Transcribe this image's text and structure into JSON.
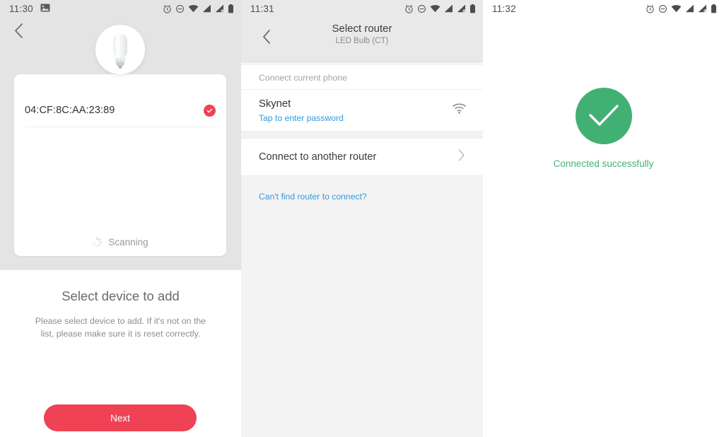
{
  "statusbar": {
    "time_1": "11:30",
    "time_2": "11:31",
    "time_3": "11:32",
    "icons": [
      "image-icon",
      "alarm-icon",
      "do-not-disturb-icon",
      "wifi-icon",
      "signal-icon",
      "signal-roaming-icon",
      "battery-icon"
    ]
  },
  "screen1": {
    "back_label": "‹",
    "device": {
      "mac": "04:CF:8C:AA:23:89",
      "selected": true
    },
    "scanning_label": "Scanning",
    "title": "Select device to add",
    "description": "Please select device to add. If it's not on the list, please make sure it is reset correctly.",
    "next_label": "Next",
    "accent_color": "#ef4255"
  },
  "screen2": {
    "title": "Select router",
    "subtitle": "LED Bulb (CT)",
    "section_label": "Connect current phone",
    "router": {
      "ssid": "Skynet",
      "hint": "Tap to enter password"
    },
    "another_router_label": "Connect to another router",
    "help_link": "Can't find router to connect?",
    "link_color": "#2f9bdd"
  },
  "screen3": {
    "status_text": "Connected successfully",
    "success_color": "#42b073"
  }
}
